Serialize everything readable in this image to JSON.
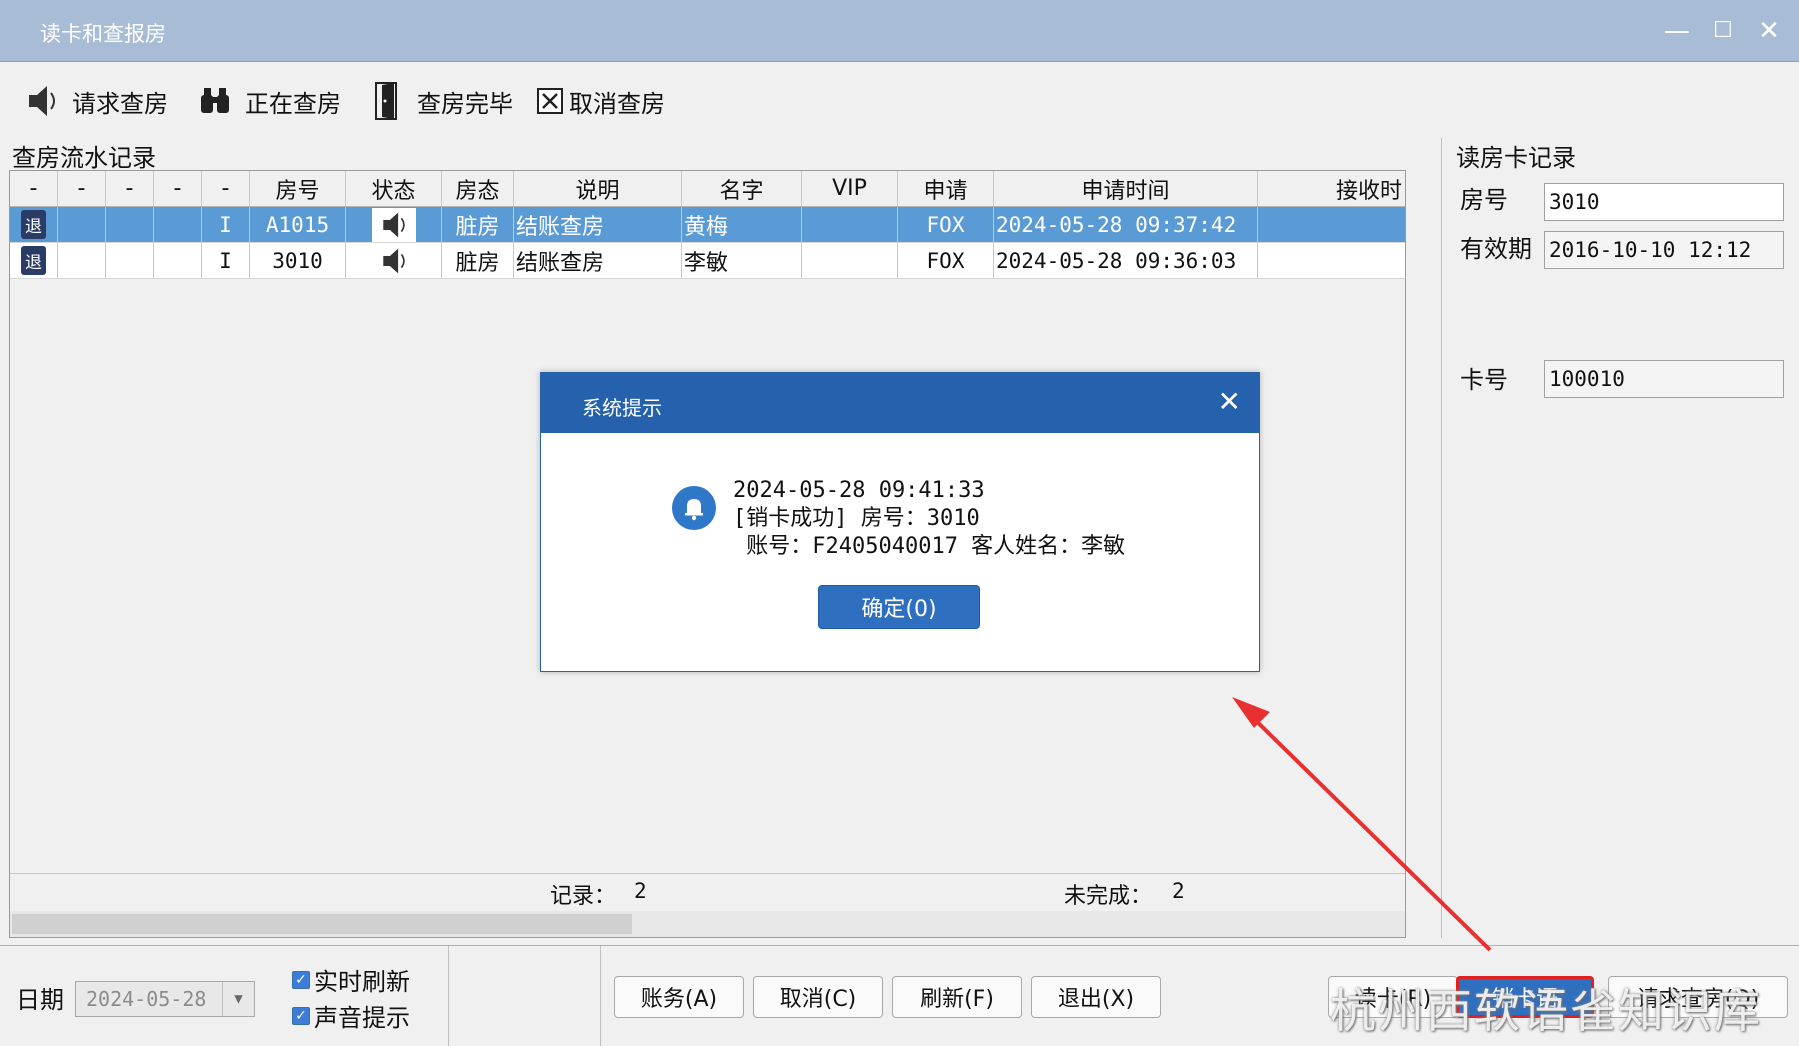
{
  "window": {
    "title": "读卡和查报房",
    "minimize": "—",
    "maximize": "☐",
    "close": "✕"
  },
  "toolbar": [
    {
      "label": "请求查房",
      "icon": "speaker-icon"
    },
    {
      "label": "正在查房",
      "icon": "binoculars-icon"
    },
    {
      "label": "查房完毕",
      "icon": "door-icon"
    },
    {
      "label": "取消查房",
      "icon": "cancel-box-icon"
    }
  ],
  "main": {
    "section_title": "查房流水记录",
    "columns": [
      "-",
      "-",
      "-",
      "-",
      "-",
      "房号",
      "状态",
      "房态",
      "说明",
      "名字",
      "VIP",
      "申请",
      "申请时间",
      "接收时"
    ],
    "rows": [
      {
        "badge": "退",
        "flag": "I",
        "room": "A1015",
        "room_state": "脏房",
        "desc": "结账查房",
        "name": "黄梅",
        "vip": "",
        "applicant": "FOX",
        "time": "2024-05-28 09:37:42",
        "recv": ""
      },
      {
        "badge": "退",
        "flag": "I",
        "room": "3010",
        "room_state": "脏房",
        "desc": "结账查房",
        "name": "李敏",
        "vip": "",
        "applicant": "FOX",
        "time": "2024-05-28 09:36:03",
        "recv": ""
      }
    ],
    "footer": {
      "records_label": "记录：",
      "records_value": "2",
      "pending_label": "未完成：",
      "pending_value": "2"
    }
  },
  "card_panel": {
    "title": "读房卡记录",
    "room_label": "房号",
    "room_value": "3010",
    "valid_label": "有效期",
    "valid_value": "2016-10-10 12:12",
    "card_label": "卡号",
    "card_value": "100010"
  },
  "bottom": {
    "date_label": "日期",
    "date_value": "2024-05-28",
    "realtime_refresh": "实时刷新",
    "sound_prompt": "声音提示",
    "buttons": [
      "账务(A)",
      "取消(C)",
      "刷新(F)",
      "退出(X)"
    ],
    "read_card": "读卡(R)",
    "cancel_card": "销卡语",
    "request_check": "请求查房(Q)"
  },
  "dialog": {
    "title": "系统提示",
    "close": "✕",
    "line1": "2024-05-28 09:41:33",
    "line2": "[销卡成功] 房号：3010",
    "line3": " 账号：F2405040017 客人姓名：李敏",
    "ok": "确定(0)"
  },
  "watermark": "杭州西软语雀知识库",
  "colors": {
    "accent": "#2561ad",
    "selection": "#5b9bd5",
    "highlight": "#e02020"
  }
}
